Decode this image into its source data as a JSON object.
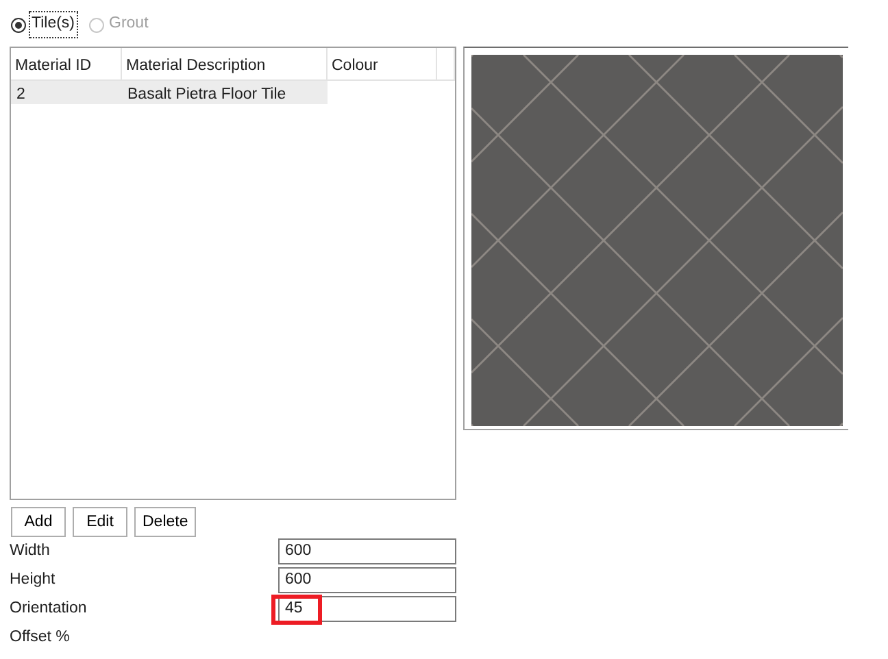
{
  "radios": [
    {
      "label": "Tile(s)",
      "selected": true,
      "disabled": false
    },
    {
      "label": "Grout",
      "selected": false,
      "disabled": true
    }
  ],
  "table": {
    "columns": [
      "Material ID",
      "Material Description",
      "Colour"
    ],
    "rows": [
      {
        "cells": [
          "2",
          "Basalt Pietra Floor Tile"
        ],
        "selected": true
      }
    ]
  },
  "buttons": [
    "Add",
    "Edit",
    "Delete"
  ],
  "fields": [
    {
      "kind": "input",
      "label": "Width",
      "value": "600",
      "highlighted": false
    },
    {
      "kind": "input",
      "label": "Height",
      "value": "600",
      "highlighted": false
    },
    {
      "kind": "input",
      "label": "Orientation",
      "value": "45",
      "highlighted": true
    },
    {
      "kind": "label",
      "label": "Offset %"
    }
  ]
}
